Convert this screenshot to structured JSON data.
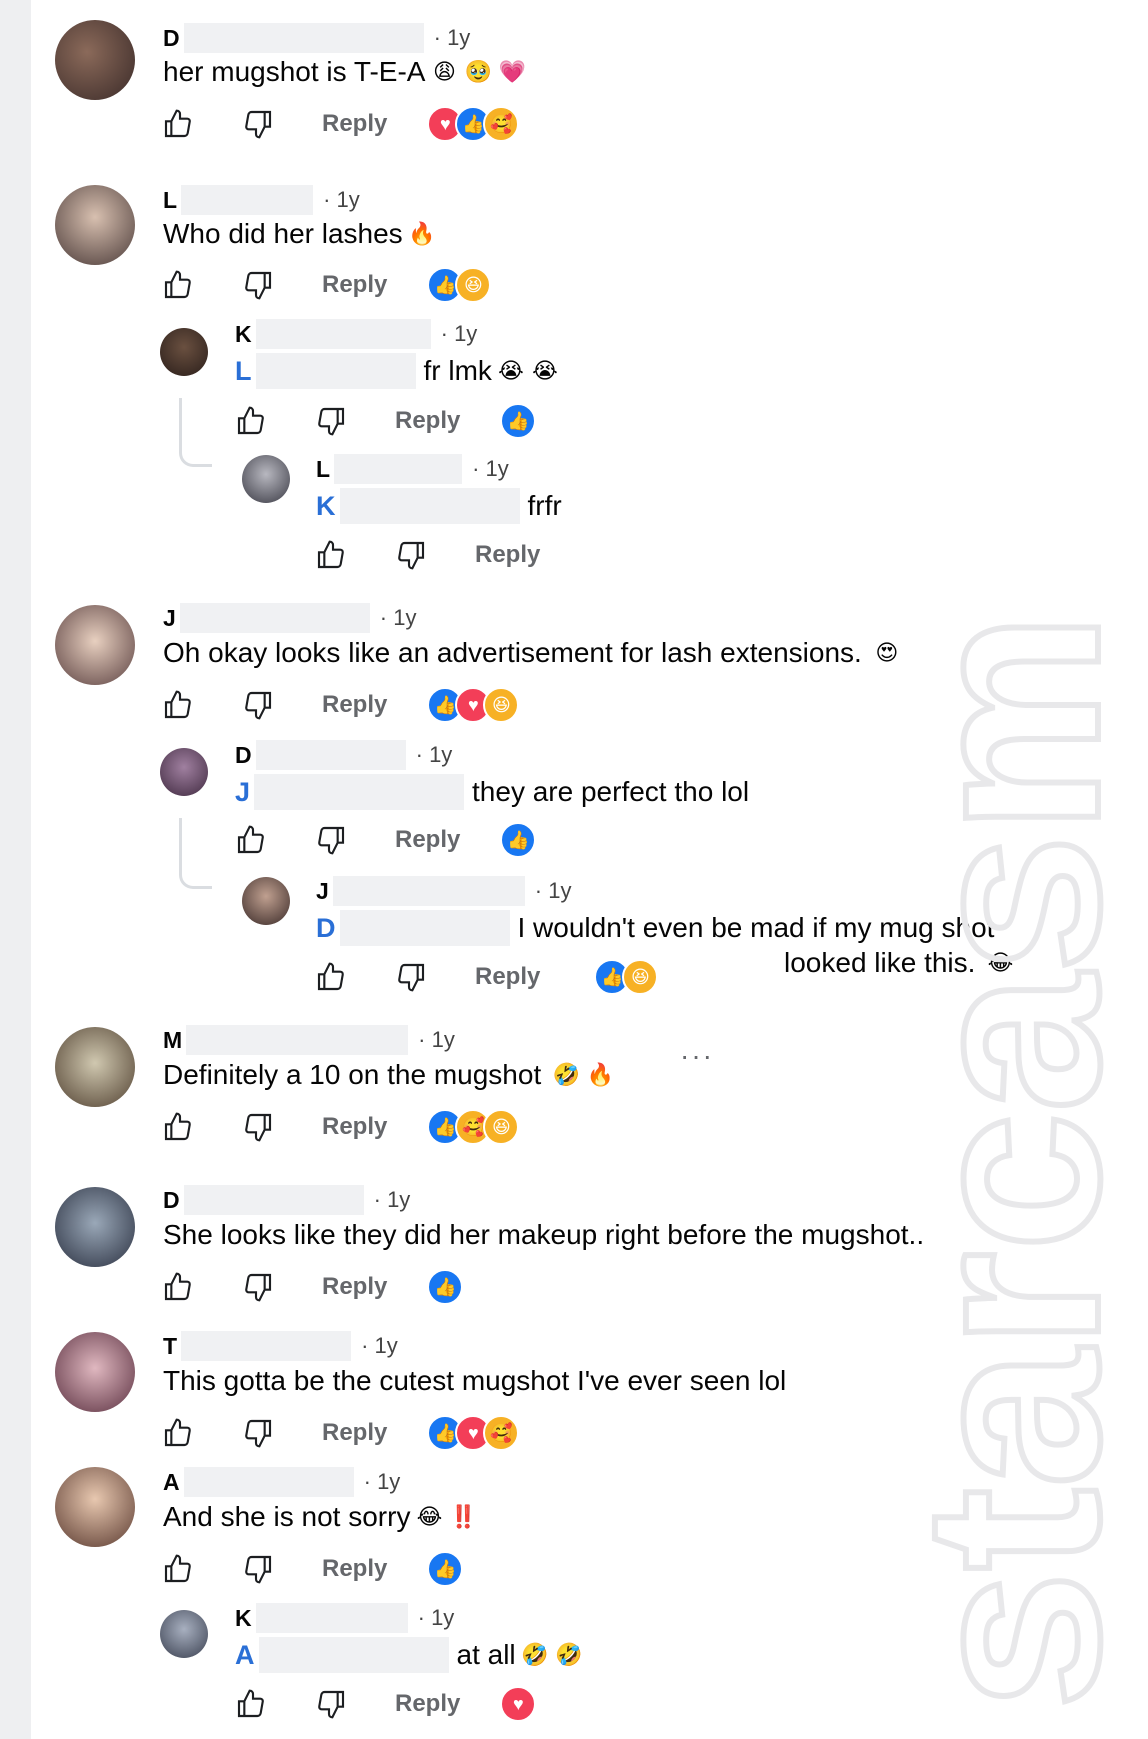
{
  "comments": [
    {
      "initial": "D",
      "time": "· 1y",
      "text": "her mugshot is T-E-A",
      "emojis": [
        "😩",
        "🥹",
        "💗"
      ],
      "reply": "Reply",
      "reactions": [
        "love",
        "like",
        "care"
      ]
    },
    {
      "initial": "L",
      "time": "· 1y",
      "text": "Who did her lashes",
      "emojis": [
        "🔥"
      ],
      "reply": "Reply",
      "reactions": [
        "like",
        "haha"
      ],
      "replies": [
        {
          "initial": "K",
          "time": "· 1y",
          "mention": "L",
          "text": "fr lmk",
          "emojis": [
            "😭",
            "😭"
          ],
          "reply": "Reply",
          "reactions": [
            "like"
          ]
        },
        {
          "initial": "L",
          "time": "· 1y",
          "mention": "K",
          "text": "frfr",
          "emojis": [],
          "reply": "Reply",
          "reactions": []
        }
      ]
    },
    {
      "initial": "J",
      "time": "· 1y",
      "text": "Oh okay looks like an advertisement for lash extensions.",
      "emojis": [
        "😍"
      ],
      "reply": "Reply",
      "reactions": [
        "like",
        "love",
        "haha"
      ],
      "replies": [
        {
          "initial": "D",
          "time": "· 1y",
          "mention": "J",
          "text": "they are perfect tho lol",
          "emojis": [],
          "reply": "Reply",
          "reactions": [
            "like"
          ]
        },
        {
          "initial": "J",
          "time": "· 1y",
          "mention": "D",
          "text": "I wouldn't even be mad if my mug shot",
          "text2": "looked like this.",
          "emojis": [
            "😂"
          ],
          "reply": "Reply",
          "reactions": [
            "like",
            "haha"
          ]
        }
      ]
    },
    {
      "initial": "M",
      "time": "· 1y",
      "text": "Definitely a 10 on the mugshot",
      "emojis": [
        "🤣",
        "🔥"
      ],
      "reply": "Reply",
      "reactions": [
        "like",
        "care",
        "haha"
      ],
      "more": "···"
    },
    {
      "initial": "D",
      "time": "· 1y",
      "text": "She looks like they did her makeup right before the mugshot..",
      "emojis": [],
      "reply": "Reply",
      "reactions": [
        "like"
      ]
    },
    {
      "initial": "T",
      "time": "· 1y",
      "text": "This gotta be the cutest mugshot I've ever seen lol",
      "emojis": [],
      "reply": "Reply",
      "reactions": [
        "like",
        "love",
        "care"
      ]
    },
    {
      "initial": "A",
      "time": "· 1y",
      "text": "And she is not sorry",
      "emojis": [
        "😂",
        "‼️"
      ],
      "reply": "Reply",
      "reactions": [
        "like"
      ],
      "replies": [
        {
          "initial": "K",
          "time": "· 1y",
          "mention": "A",
          "text": "at all",
          "emojis": [
            "🤣",
            "🤣"
          ],
          "reply": "Reply",
          "reactions": [
            "love"
          ]
        }
      ]
    }
  ],
  "watermark": "starcasm",
  "colors": {
    "like": "#1877f2",
    "love": "#f33e58",
    "haha": "#f7b125",
    "mention": "#2a6fd6"
  }
}
